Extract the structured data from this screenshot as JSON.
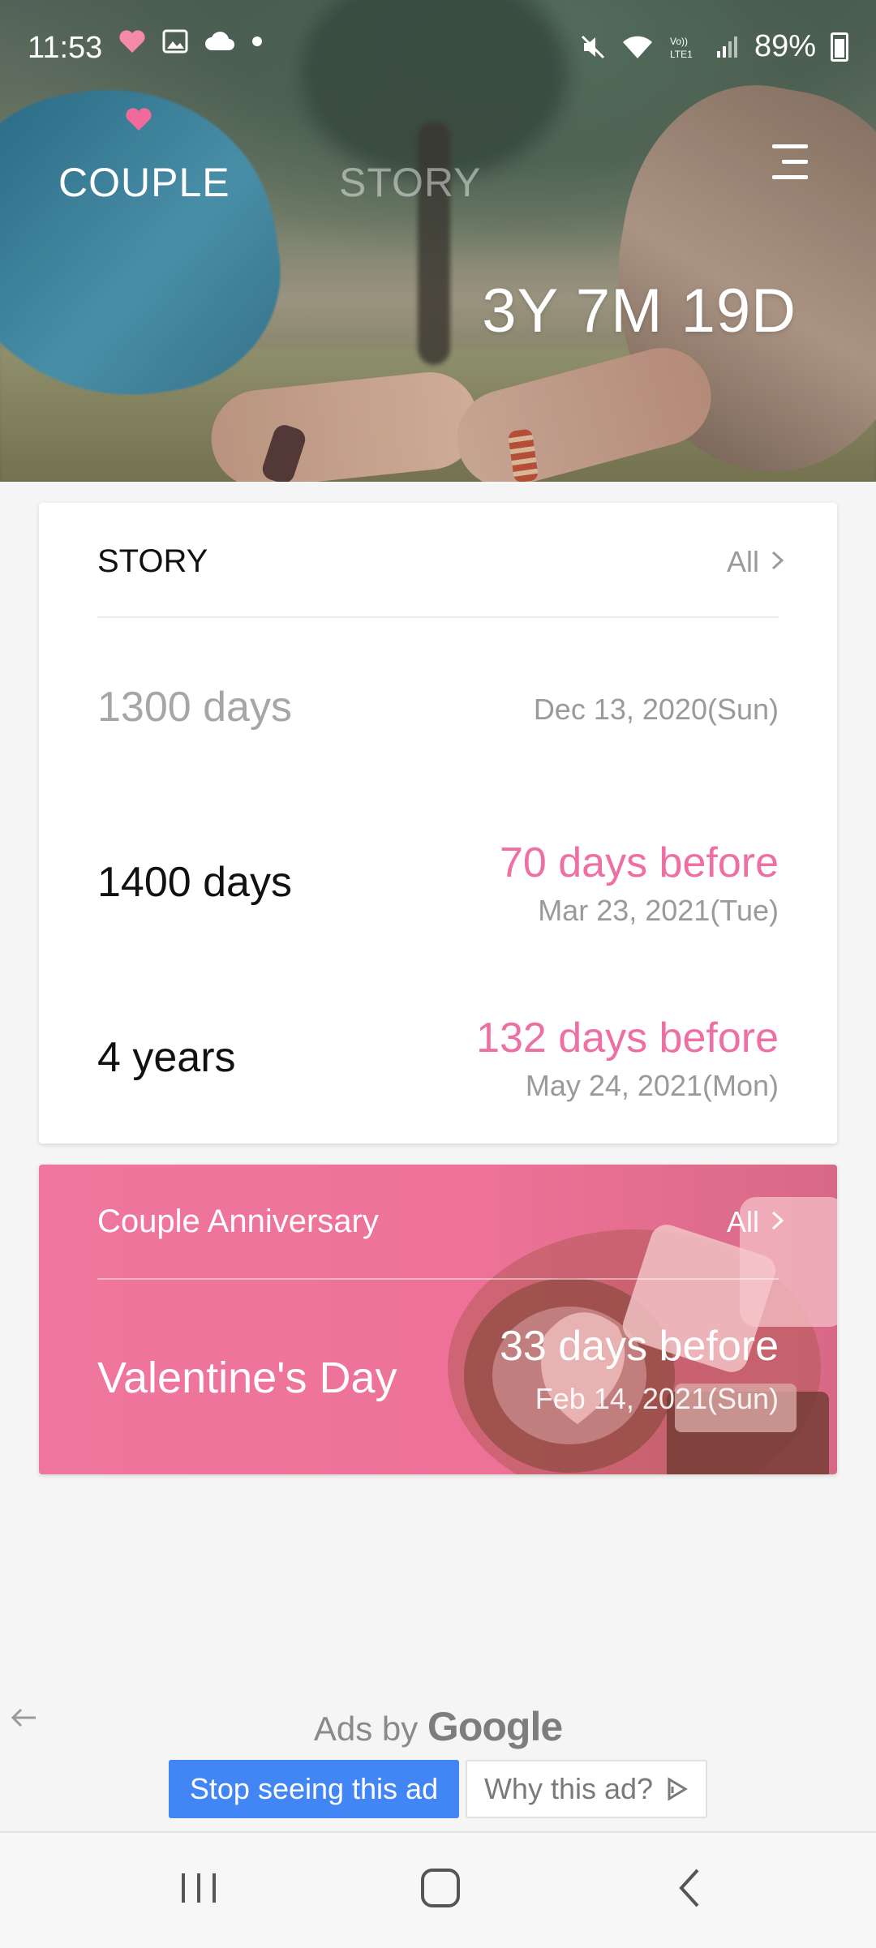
{
  "status_bar": {
    "time": "11:53",
    "battery": "89%",
    "left_icons": [
      "heart-icon",
      "gallery-icon",
      "cloud-sync-icon",
      "dot-icon"
    ],
    "right_icons": [
      "mute-icon",
      "wifi-icon",
      "volte-lte-icon",
      "signal-icon",
      "battery-icon"
    ]
  },
  "header": {
    "tabs": [
      {
        "label": "COUPLE",
        "active": true
      },
      {
        "label": "STORY",
        "active": false
      }
    ],
    "counter": "3Y 7M 19D"
  },
  "story_card": {
    "title": "STORY",
    "all_label": "All",
    "rows": [
      {
        "title": "1300 days",
        "before": "",
        "date": "Dec 13, 2020(Sun)",
        "past": true
      },
      {
        "title": "1400 days",
        "before": "70 days before",
        "date": "Mar 23, 2021(Tue)",
        "past": false
      },
      {
        "title": "4 years",
        "before": "132 days before",
        "date": "May 24, 2021(Mon)",
        "past": false
      }
    ]
  },
  "anniversary_card": {
    "title": "Couple Anniversary",
    "all_label": "All",
    "event": "Valentine's Day",
    "before": "33 days before",
    "date": "Feb 14, 2021(Sun)"
  },
  "ad": {
    "ads_by": "Ads by",
    "brand": "Google",
    "stop_label": "Stop seeing this ad",
    "why_label": "Why this ad?"
  },
  "colors": {
    "accent_pink": "#ee6fa3",
    "card_pink": "#ef769e",
    "ad_blue": "#4285f4"
  }
}
